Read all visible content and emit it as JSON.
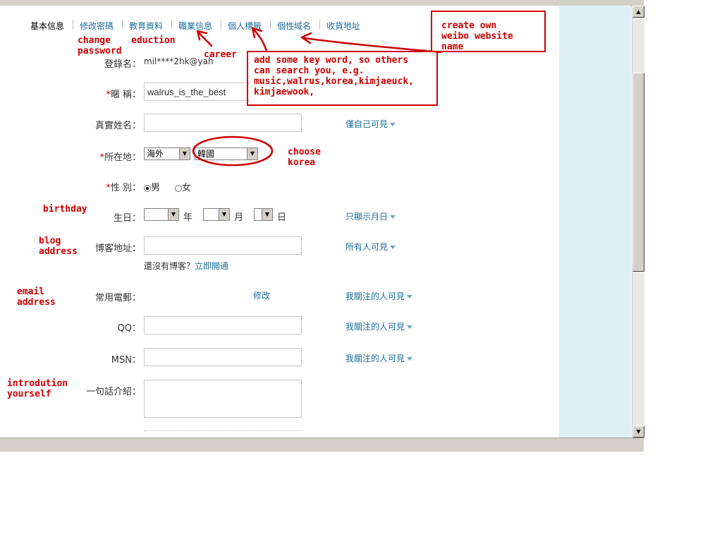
{
  "tabs": [
    {
      "label": "基本信息",
      "active": true
    },
    {
      "label": "修改密碼"
    },
    {
      "label": "教育資料"
    },
    {
      "label": "職業信息"
    },
    {
      "label": "個人標籤"
    },
    {
      "label": "個性域名"
    },
    {
      "label": "收貨地址"
    }
  ],
  "form": {
    "login_label": "登錄名：",
    "login_value": "mil****2hk@yah",
    "nickname_label": "暱 稱：",
    "nickname_value": "walrus_is_the_best",
    "realname_label": "真實姓名：",
    "location_label": "所在地：",
    "location_country": "海外",
    "location_region": "韓國",
    "gender_label": "性 別：",
    "gender_male": "男",
    "gender_female": "女",
    "birthday_label": "生日：",
    "year": "年",
    "month": "月",
    "day": "日",
    "blog_label": "博客地址：",
    "blog_hint": "還沒有博客？",
    "blog_link": "立即開通",
    "email_label": "常用電郵：",
    "email_edit": "修改",
    "qq_label": "QQ：",
    "msn_label": "MSN：",
    "intro_label": "一句話介紹：",
    "required_mark": "*"
  },
  "privacy": {
    "realname": "僅自己可見",
    "birthday": "只顯示月日",
    "blog": "所有人可見",
    "email": "我關注的人可見",
    "qq": "我關注的人可見",
    "msn": "我關注的人可見"
  },
  "annotations": {
    "change_password": "change\npassword",
    "education": "eduction",
    "career": "career",
    "tags": "add some key word, so others\ncan search you, e.g.\nmusic,walrus,korea,kimjaeuck,\nkimjaewook,",
    "domain": "create own\nweibo website\nname",
    "korea": "choose\nkorea",
    "birthday": "birthday",
    "blog": "blog\naddress",
    "email": "email\naddress",
    "intro": "introdution\nyourself"
  },
  "colors": {
    "link": "#1a6e9a",
    "annotation": "#cc0000",
    "side_panel": "#dff0f7"
  }
}
